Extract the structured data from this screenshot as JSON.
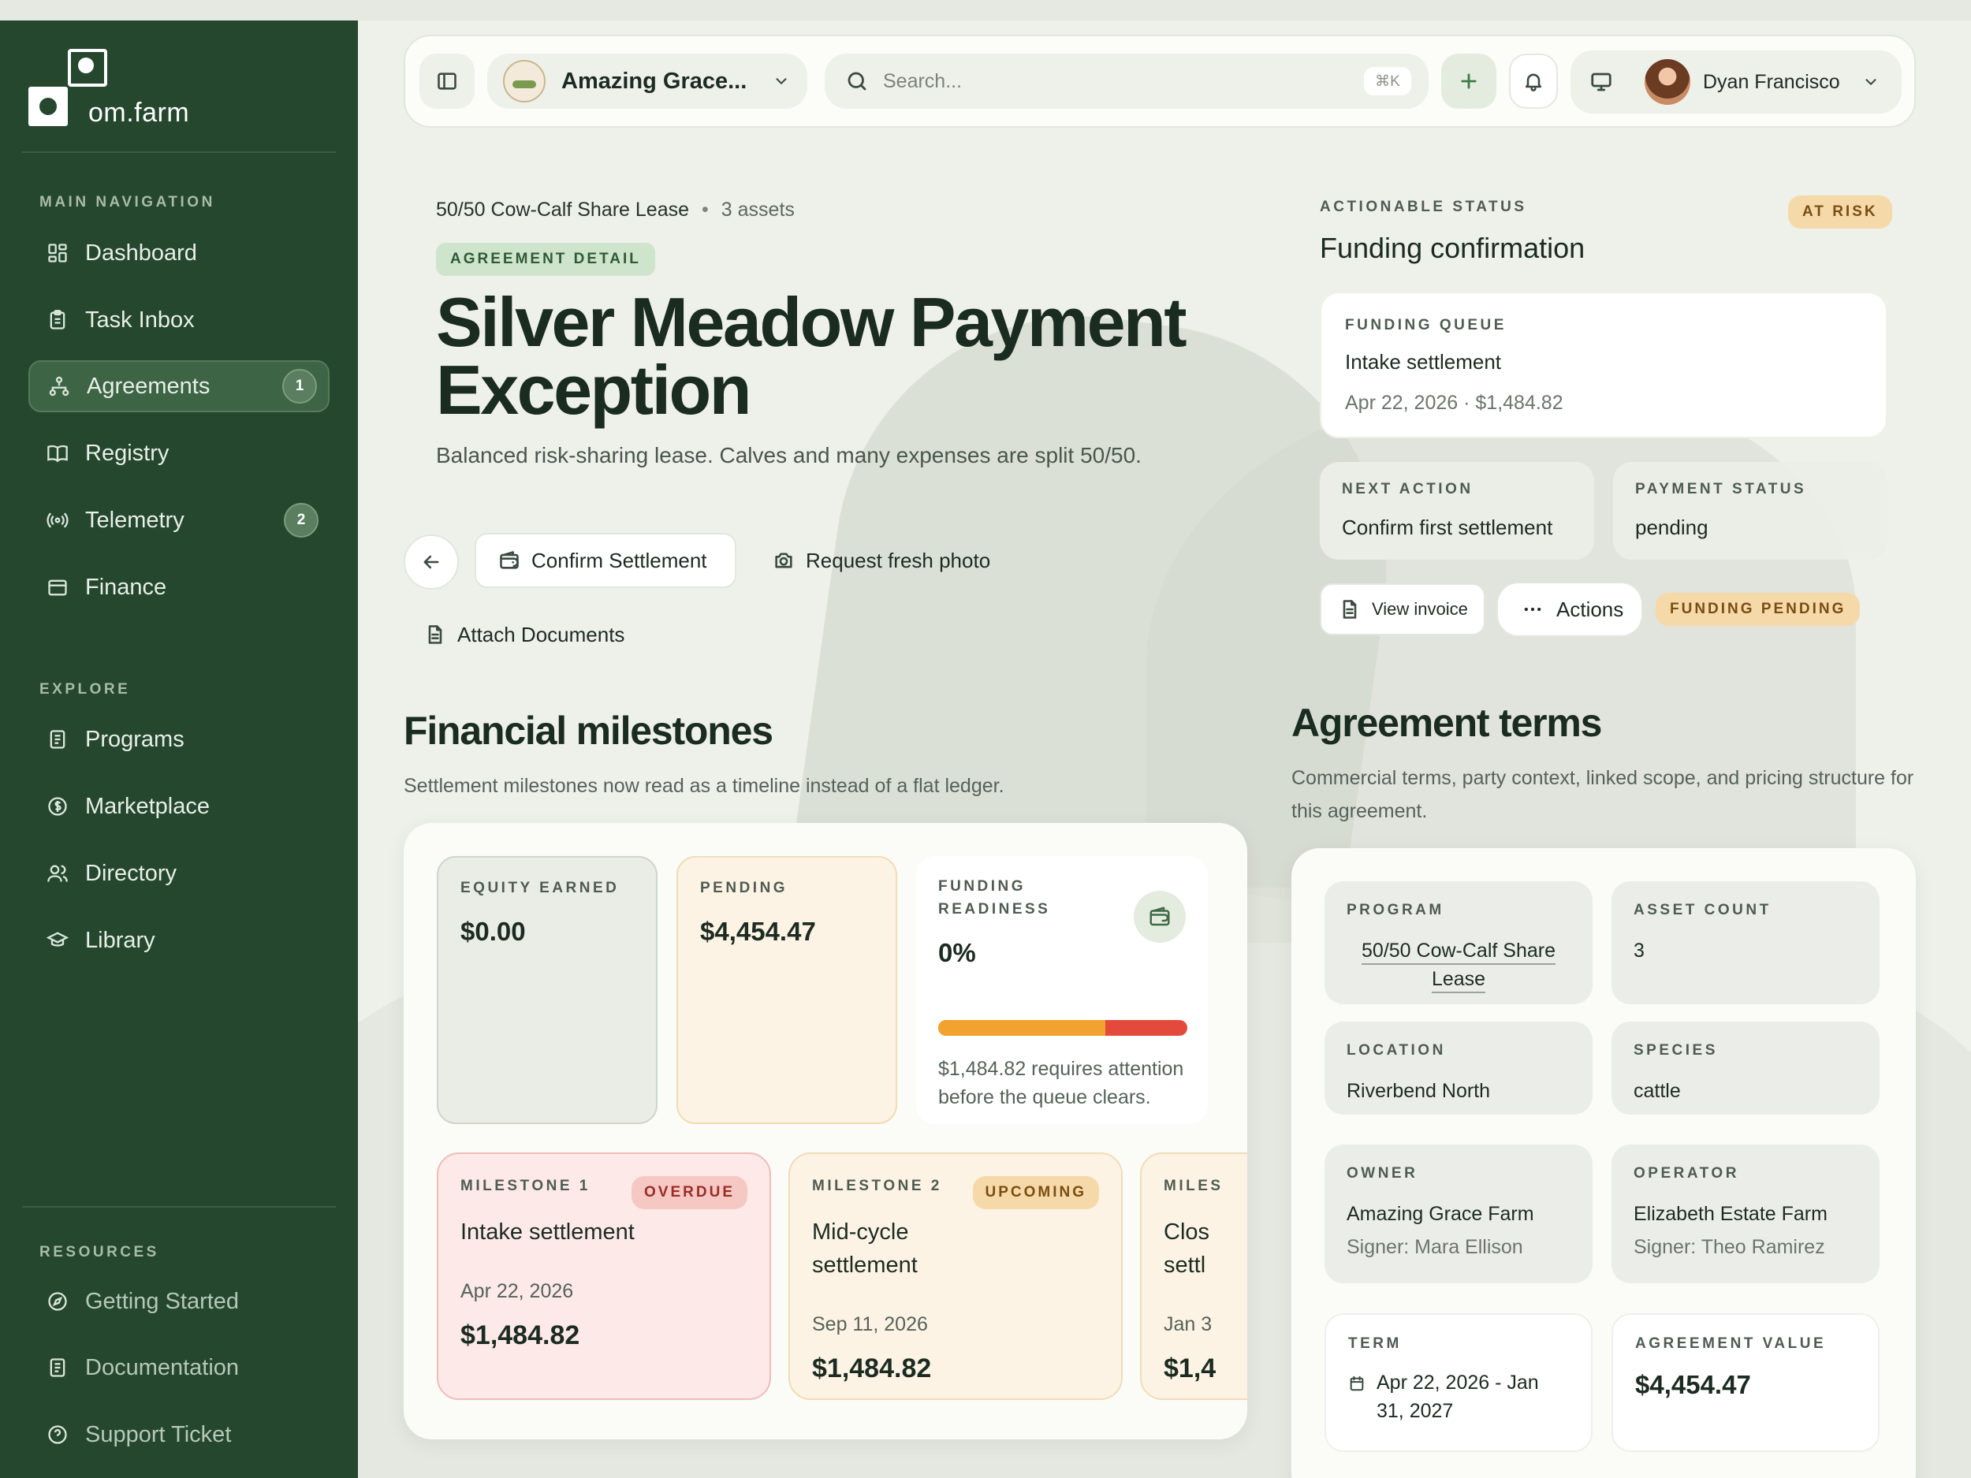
{
  "sidebar": {
    "brand": "om.farm",
    "main_label": "MAIN NAVIGATION",
    "main_items": [
      {
        "label": "Dashboard",
        "icon": "dashboard-icon"
      },
      {
        "label": "Task Inbox",
        "icon": "clipboard-icon"
      },
      {
        "label": "Agreements",
        "icon": "hierarchy-icon",
        "badge": "1",
        "active": true
      },
      {
        "label": "Registry",
        "icon": "book-icon"
      },
      {
        "label": "Telemetry",
        "icon": "signal-icon",
        "badge": "2"
      },
      {
        "label": "Finance",
        "icon": "wallet-icon"
      }
    ],
    "explore_label": "EXPLORE",
    "explore_items": [
      {
        "label": "Programs",
        "icon": "document-icon"
      },
      {
        "label": "Marketplace",
        "icon": "dollar-icon"
      },
      {
        "label": "Directory",
        "icon": "users-icon"
      },
      {
        "label": "Library",
        "icon": "graduation-icon"
      }
    ],
    "resources_label": "RESOURCES",
    "resource_items": [
      {
        "label": "Getting Started",
        "icon": "compass-icon"
      },
      {
        "label": "Documentation",
        "icon": "document-icon"
      },
      {
        "label": "Support Ticket",
        "icon": "help-icon"
      }
    ]
  },
  "topbar": {
    "farm_name": "Amazing Grace...",
    "search_placeholder": "Search...",
    "search_shortcut": "⌘K",
    "user_name": "Dyan Francisco"
  },
  "header": {
    "breadcrumb_program": "50/50 Cow-Calf Share Lease",
    "breadcrumb_assets": "3 assets",
    "tag": "AGREEMENT DETAIL",
    "title": "Silver Meadow Payment Exception",
    "subtitle": "Balanced risk-sharing lease. Calves and many expenses are split 50/50.",
    "btn_confirm": "Confirm Settlement",
    "btn_photo": "Request fresh photo",
    "btn_attach": "Attach Documents"
  },
  "status": {
    "eyebrow": "ACTIONABLE STATUS",
    "risk_tag": "AT RISK",
    "title": "Funding confirmation",
    "queue_label": "FUNDING QUEUE",
    "queue_value": "Intake settlement",
    "queue_detail": "Apr 22, 2026 · $1,484.82",
    "next_label": "NEXT ACTION",
    "next_value": "Confirm first settlement",
    "payment_label": "PAYMENT STATUS",
    "payment_value": "pending",
    "invoice_btn": "View invoice",
    "actions_btn": "Actions",
    "pending_tag": "FUNDING PENDING"
  },
  "financial": {
    "title": "Financial milestones",
    "subtitle": "Settlement milestones now read as a timeline instead of a flat ledger.",
    "equity_label": "EQUITY EARNED",
    "equity_value": "$0.00",
    "pending_label": "PENDING",
    "pending_value": "$4,454.47",
    "ready_label": "FUNDING READINESS",
    "ready_value": "0%",
    "ready_bar_fraction": 0.67,
    "ready_note": "$1,484.82 requires attention before the queue clears.",
    "milestones": [
      {
        "label": "MILESTONE 1",
        "tag": "OVERDUE",
        "name": "Intake settlement",
        "date": "Apr 22, 2026",
        "amount": "$1,484.82"
      },
      {
        "label": "MILESTONE 2",
        "tag": "UPCOMING",
        "name": "Mid-cycle settlement",
        "date": "Sep 11, 2026",
        "amount": "$1,484.82"
      },
      {
        "label": "MILES",
        "tag": "",
        "name": "Clos settl",
        "date": "Jan 3",
        "amount": "$1,4"
      }
    ]
  },
  "terms": {
    "title": "Agreement terms",
    "subtitle": "Commercial terms, party context, linked scope, and pricing structure for this agreement.",
    "program_label": "PROGRAM",
    "program_value": "50/50 Cow-Calf Share Lease",
    "asset_label": "ASSET COUNT",
    "asset_value": "3",
    "location_label": "LOCATION",
    "location_value": "Riverbend North",
    "species_label": "SPECIES",
    "species_value": "cattle",
    "owner_label": "OWNER",
    "owner_value": "Amazing Grace Farm",
    "owner_signer": "Signer: Mara Ellison",
    "operator_label": "OPERATOR",
    "operator_value": "Elizabeth Estate Farm",
    "operator_signer": "Signer: Theo Ramirez",
    "term_label": "TERM",
    "term_value": "Apr 22, 2026 - Jan 31, 2027",
    "value_label": "AGREEMENT VALUE",
    "value_value": "$4,454.47"
  }
}
